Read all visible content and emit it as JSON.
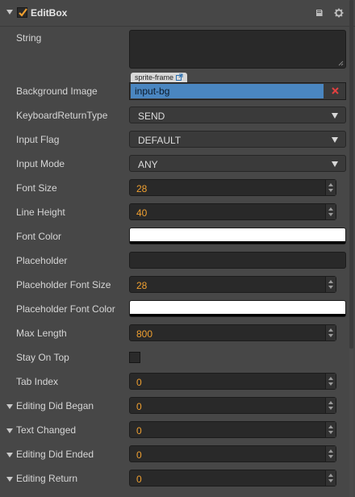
{
  "component": {
    "title": "EditBox",
    "enabled": true
  },
  "header_icons": [
    "book-icon",
    "gear-icon"
  ],
  "properties": {
    "string": {
      "label": "String",
      "value": ""
    },
    "background_image": {
      "label": "Background Image",
      "tag": "sprite-frame",
      "value": "input-bg"
    },
    "keyboard_return_type": {
      "label": "KeyboardReturnType",
      "value": "SEND"
    },
    "input_flag": {
      "label": "Input Flag",
      "value": "DEFAULT"
    },
    "input_mode": {
      "label": "Input Mode",
      "value": "ANY"
    },
    "font_size": {
      "label": "Font Size",
      "value": "28"
    },
    "line_height": {
      "label": "Line Height",
      "value": "40"
    },
    "font_color": {
      "label": "Font Color",
      "color": "#ffffff"
    },
    "placeholder": {
      "label": "Placeholder",
      "value": ""
    },
    "placeholder_font_size": {
      "label": "Placeholder Font Size",
      "value": "28"
    },
    "placeholder_font_color": {
      "label": "Placeholder Font Color",
      "color": "#ffffff"
    },
    "max_length": {
      "label": "Max Length",
      "value": "800"
    },
    "stay_on_top": {
      "label": "Stay On Top",
      "checked": false
    },
    "tab_index": {
      "label": "Tab Index",
      "value": "0"
    }
  },
  "events": [
    {
      "label": "Editing Did Began",
      "value": "0"
    },
    {
      "label": "Text Changed",
      "value": "0"
    },
    {
      "label": "Editing Did Ended",
      "value": "0"
    },
    {
      "label": "Editing Return",
      "value": "0"
    }
  ],
  "colors": {
    "panel_bg": "#474747",
    "field_bg": "#292929",
    "number": "#f0a030",
    "asset_blue": "#4a86c0",
    "accent_check": "#f0a030",
    "remove_red": "#e04040"
  }
}
